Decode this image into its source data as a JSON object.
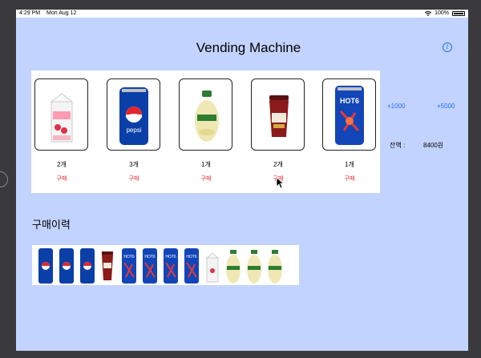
{
  "status_bar": {
    "time": "4:29 PM",
    "date": "Mon Aug 12",
    "battery": "100%"
  },
  "title": "Vending Machine",
  "info_icon": "info-icon",
  "products": [
    {
      "name": "strawberry-milk",
      "count": "2개",
      "buy_label": "구매"
    },
    {
      "name": "pepsi",
      "count": "3개",
      "buy_label": "구매"
    },
    {
      "name": "banana-milk",
      "count": "1개",
      "buy_label": "구매"
    },
    {
      "name": "coffee-cup",
      "count": "2개",
      "buy_label": "구매"
    },
    {
      "name": "hot6",
      "count": "1개",
      "buy_label": "구매"
    }
  ],
  "add_money": {
    "plus_1000": "+1000",
    "plus_5000": "+5000"
  },
  "balance": {
    "label": "잔액 :",
    "value": "8400원"
  },
  "history": {
    "title": "구매이력",
    "items": [
      "pepsi",
      "pepsi",
      "pepsi",
      "coffee-cup",
      "hot6",
      "hot6",
      "hot6",
      "hot6",
      "strawberry-milk",
      "banana-milk",
      "banana-milk",
      "banana-milk"
    ]
  },
  "colors": {
    "background": "#c3d3ff",
    "accent": "#1e6fff",
    "buy": "#e02020"
  }
}
